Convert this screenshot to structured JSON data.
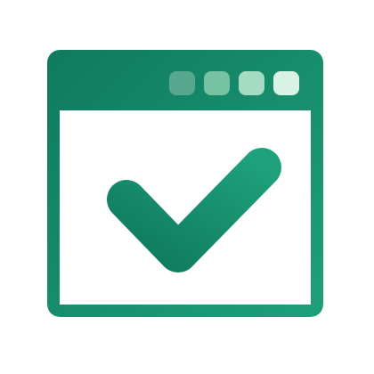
{
  "window": {
    "gradient_start": "#0f7a5e",
    "gradient_end": "#1ea07a",
    "title_dots": [
      {
        "name": "title-dot-1",
        "color": "#56a78d"
      },
      {
        "name": "title-dot-2",
        "color": "#76c2a3"
      },
      {
        "name": "title-dot-3",
        "color": "#a3dbc3"
      },
      {
        "name": "title-dot-4",
        "color": "#d9f2e6"
      }
    ]
  },
  "content": {
    "icon": "checkmark-icon",
    "icon_color_start": "#0f7a5e",
    "icon_color_end": "#1ea07a"
  }
}
